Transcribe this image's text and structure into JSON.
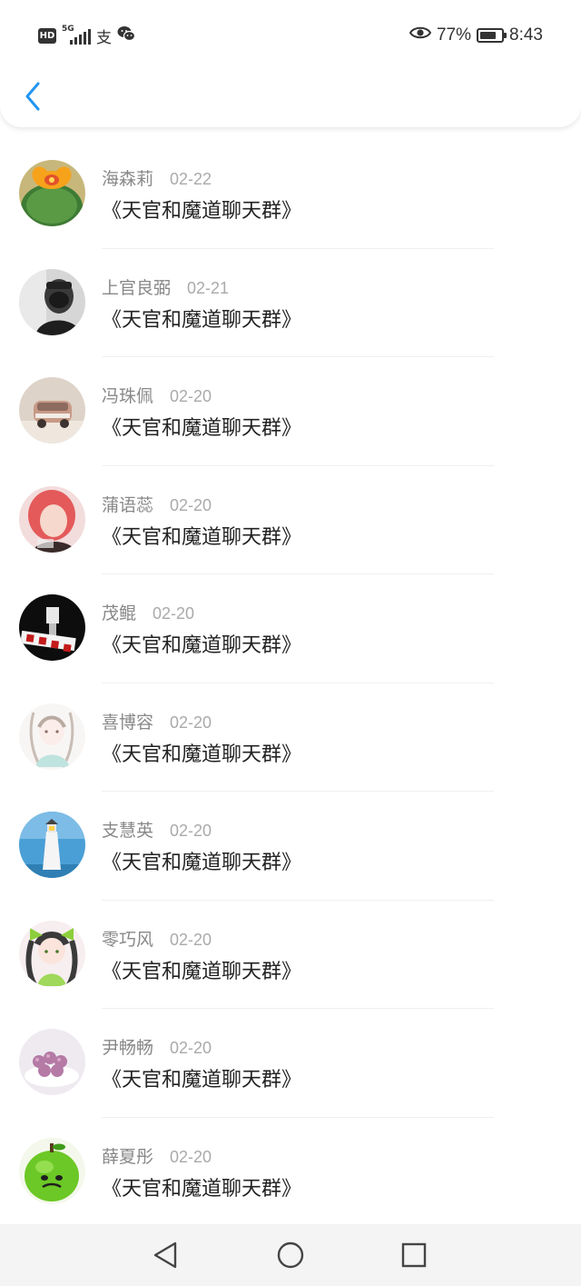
{
  "status_bar": {
    "network_type": "5G",
    "hd_label": "HD",
    "app_glyph_1": "支",
    "app_glyph_2": "✿",
    "battery_percent": "77%",
    "battery_level": 0.77,
    "time": "8:43"
  },
  "header": {
    "back_icon": "chevron-left-icon",
    "accent_color": "#2196f3"
  },
  "messages": [
    {
      "name": "海森莉",
      "date": "02-22",
      "text": "《天官和魔道聊天群》"
    },
    {
      "name": "上官良弼",
      "date": "02-21",
      "text": "《天官和魔道聊天群》"
    },
    {
      "name": "冯珠佩",
      "date": "02-20",
      "text": "《天官和魔道聊天群》"
    },
    {
      "name": "蒲语蕊",
      "date": "02-20",
      "text": "《天官和魔道聊天群》"
    },
    {
      "name": "茂鲲",
      "date": "02-20",
      "text": "《天官和魔道聊天群》"
    },
    {
      "name": "喜博容",
      "date": "02-20",
      "text": "《天官和魔道聊天群》"
    },
    {
      "name": "支慧英",
      "date": "02-20",
      "text": "《天官和魔道聊天群》"
    },
    {
      "name": "零巧风",
      "date": "02-20",
      "text": "《天官和魔道聊天群》"
    },
    {
      "name": "尹畅畅",
      "date": "02-20",
      "text": "《天官和魔道聊天群》"
    },
    {
      "name": "薛夏彤",
      "date": "02-20",
      "text": "《天官和魔道聊天群》"
    }
  ],
  "nav_bar": {
    "back_icon": "triangle-back-icon",
    "home_icon": "circle-home-icon",
    "recents_icon": "square-recents-icon"
  }
}
